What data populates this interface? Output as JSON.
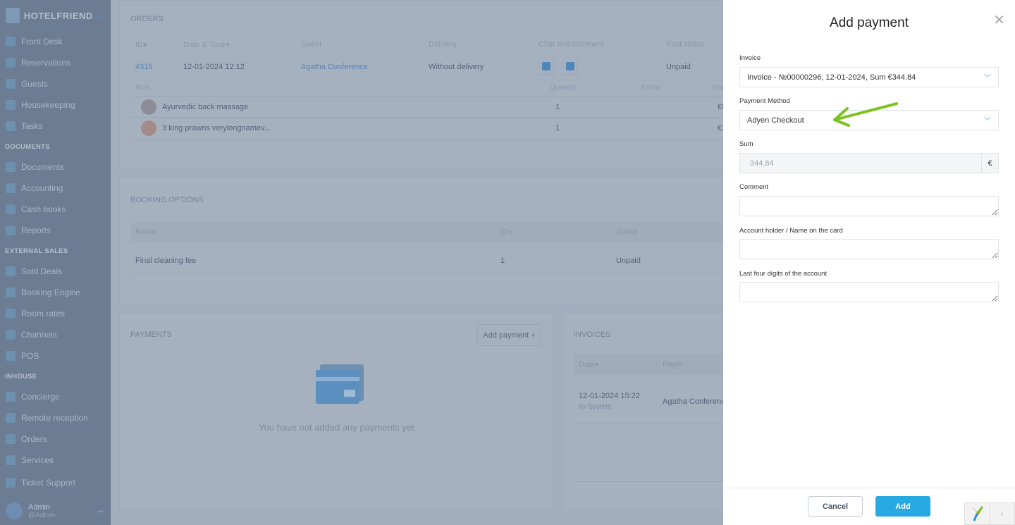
{
  "sidebar": {
    "brand": "HOTELFRIEND",
    "items1": [
      "Front Desk",
      "Reservations",
      "Guests",
      "Housekeeping",
      "Tasks"
    ],
    "section_documents": "DOCUMENTS",
    "items2": [
      "Documents",
      "Accounting",
      "Cash books",
      "Reports"
    ],
    "section_external": "EXTERNAL SALES",
    "items3": [
      "Sold Deals",
      "Booking Engine",
      "Room rates",
      "Channels",
      "POS"
    ],
    "section_inhouse": "INHOUSE",
    "items4": [
      "Concierge",
      "Remote reception",
      "Orders",
      "Services"
    ],
    "ticket": "Ticket Support",
    "user": {
      "name": "Admin",
      "handle": "@Admin"
    }
  },
  "orders": {
    "title": "ORDERS",
    "headers": [
      "ID",
      "Date & Time",
      "Guest",
      "Delivery",
      "Chat and comment",
      "Paid status"
    ],
    "row": {
      "id": "#315",
      "datetime": "12-01-2024 12:12",
      "guest": "Agatha Conference",
      "delivery": "Without delivery",
      "paid": "Unpaid"
    },
    "item_headers": [
      "Item",
      "Quantity",
      "Extras",
      "Pric"
    ],
    "items": [
      {
        "name": "Ayurvedic back massage",
        "qty": "1",
        "price": "€0"
      },
      {
        "name": "3 king prawns verylongnamev...",
        "qty": "1",
        "price": "€1"
      }
    ]
  },
  "booking": {
    "title": "BOOKING OPTIONS",
    "headers": [
      "Name",
      "Qty",
      "Status"
    ],
    "row": {
      "name": "Final cleaning fee",
      "qty": "1",
      "status": "Unpaid"
    }
  },
  "payments": {
    "title": "PAYMENTS",
    "add": "Add payment +",
    "empty": "You have not added any payments yet"
  },
  "invoices": {
    "title": "INVOICES",
    "headers": [
      "Date",
      "Payer"
    ],
    "row": {
      "date": "12-01-2024 15:22",
      "by": "by System",
      "payer": "Agatha Conference"
    }
  },
  "panel": {
    "title": "Add payment",
    "invoice_label": "Invoice",
    "invoice_value": "Invoice - №00000296, 12-01-2024, Sum €344.84",
    "method_label": "Payment Method",
    "method_value": "Adyen Checkout",
    "sum_label": "Sum",
    "sum_value": "344.84",
    "currency": "€",
    "comment_label": "Comment",
    "holder_label": "Account holder / Name on the card",
    "digits_label": "Last four digits of the account",
    "cancel": "Cancel",
    "add": "Add"
  },
  "colors": {
    "accent": "#27aae3",
    "arrow": "#7cc320"
  }
}
